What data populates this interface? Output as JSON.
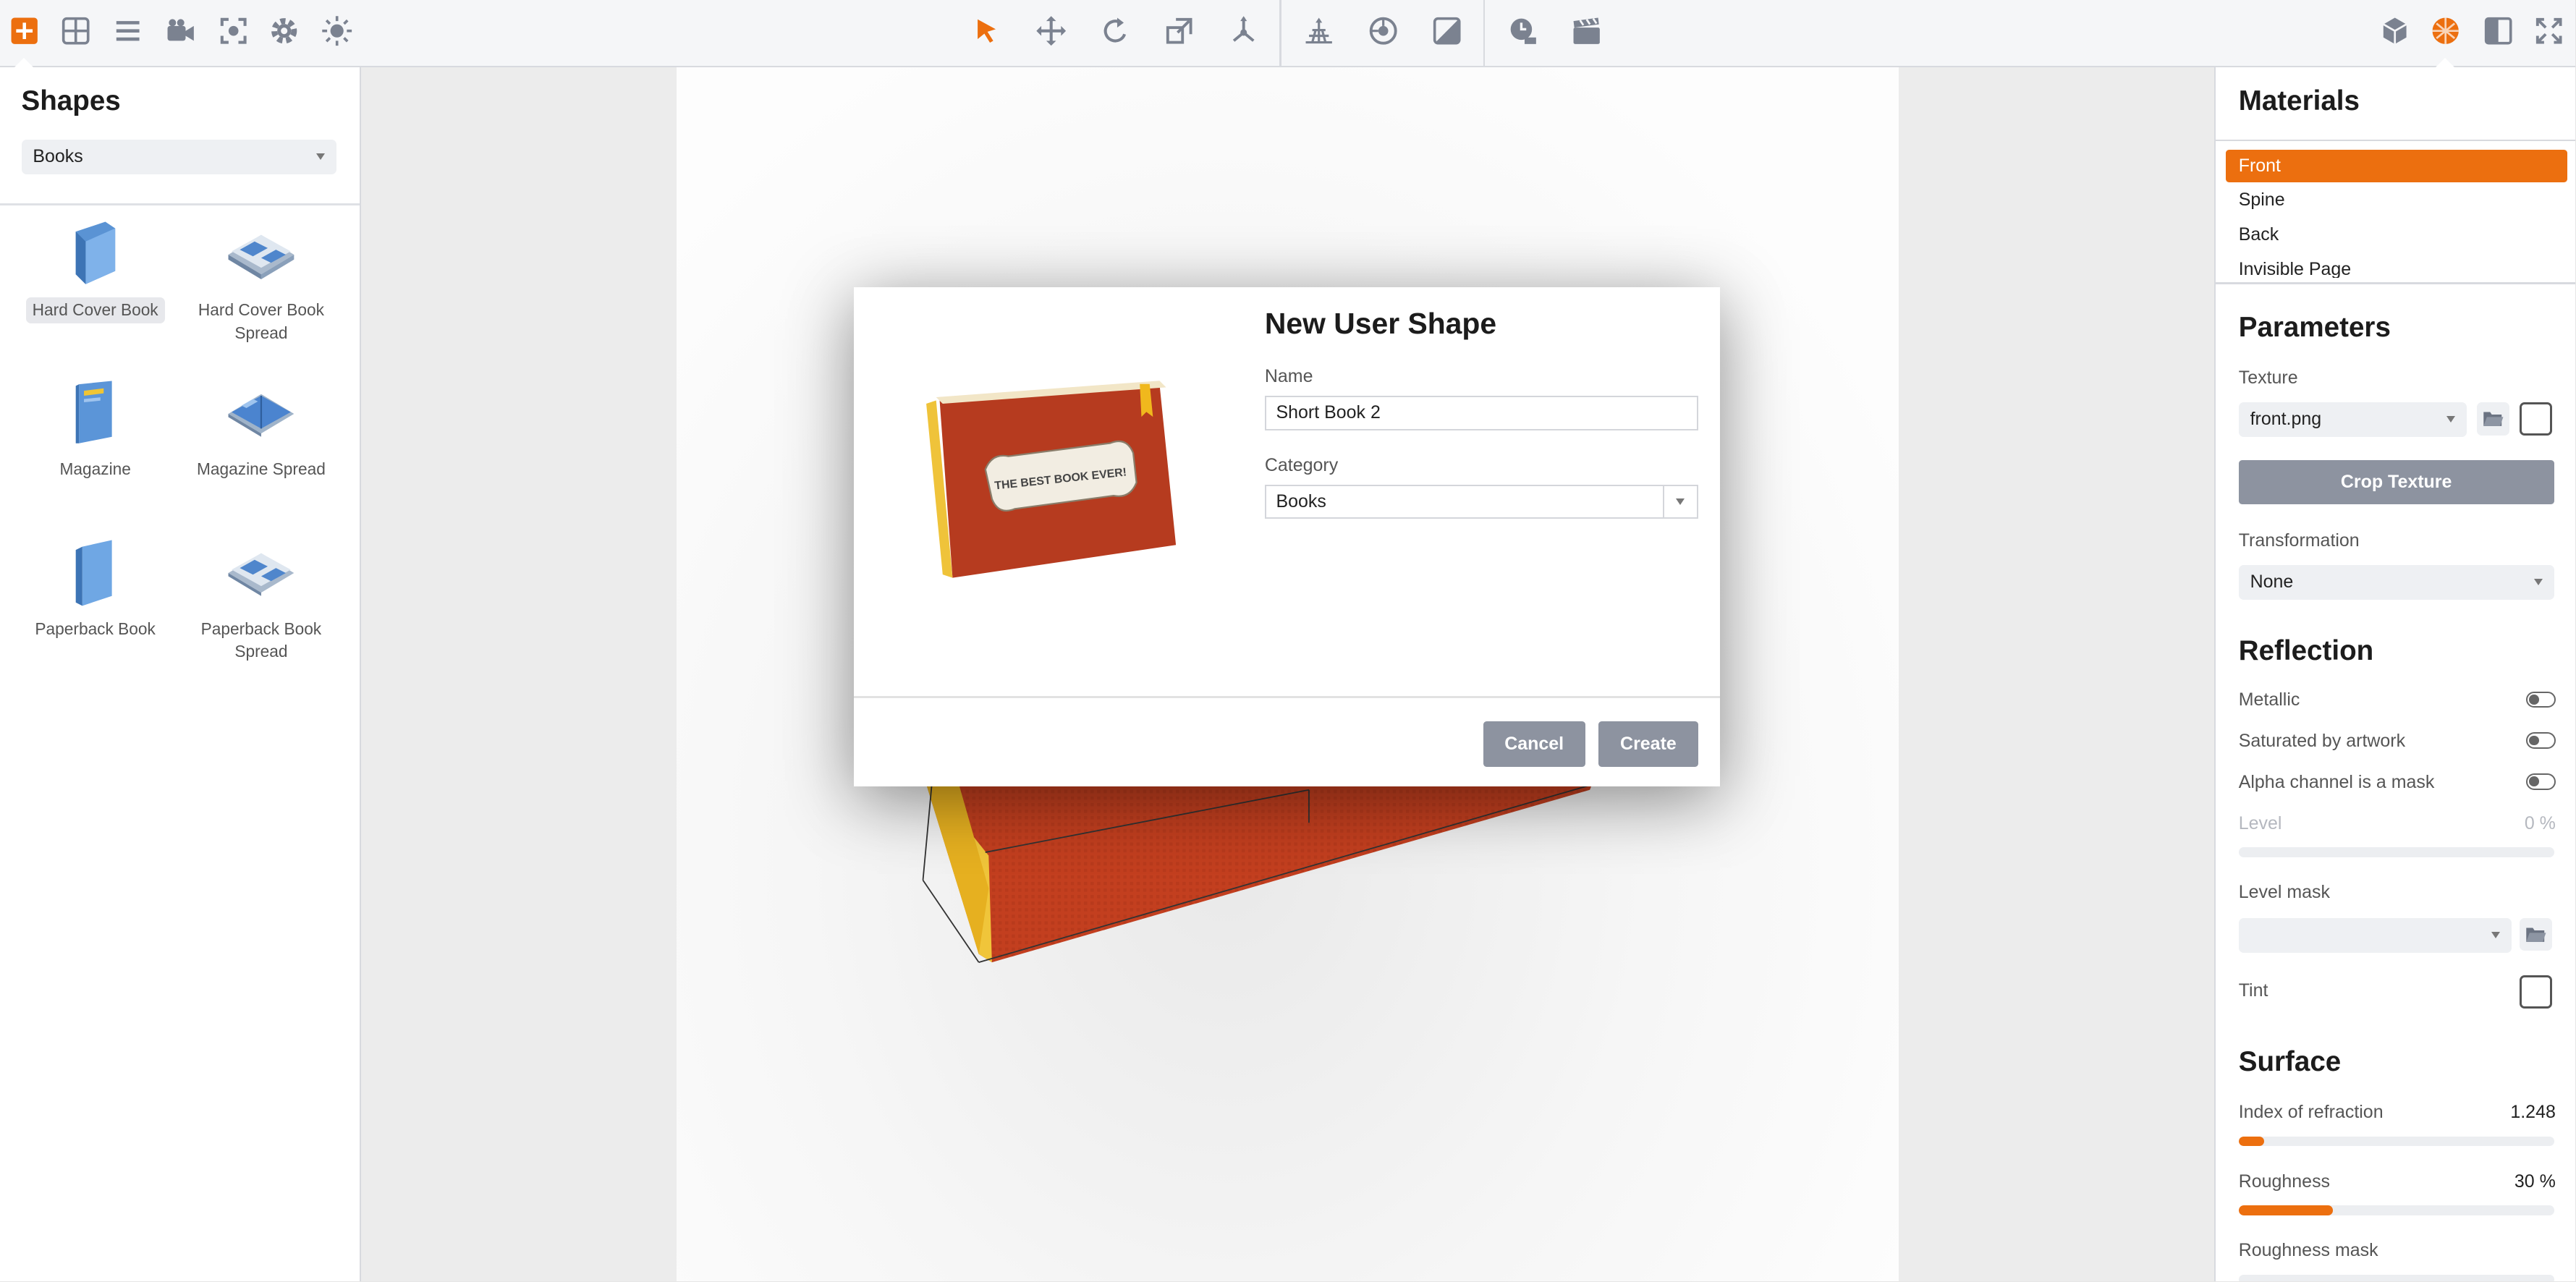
{
  "toolbar": {
    "left_icons": [
      "add-icon",
      "grid-icon",
      "list-icon",
      "camera-icon",
      "focus-icon",
      "gear-icon",
      "light-icon"
    ],
    "center_icons": [
      "select-arrow-icon",
      "move-icon",
      "rotate-icon",
      "scale-icon",
      "pivot-icon",
      "floor-grid-icon",
      "sphere-icon",
      "shading-icon",
      "time-icon",
      "clapper-icon"
    ],
    "right_icons": [
      "cube-icon",
      "material-ball-icon",
      "layout-icon",
      "fullscreen-icon"
    ],
    "accent": "#ec6f0f"
  },
  "shapes_panel": {
    "title": "Shapes",
    "category": "Books",
    "items": [
      {
        "label": "Hard Cover Book",
        "icon": "hard-cover-book-icon",
        "selected": true
      },
      {
        "label": "Hard Cover Book Spread",
        "icon": "hard-cover-spread-icon"
      },
      {
        "label": "Magazine",
        "icon": "magazine-icon"
      },
      {
        "label": "Magazine Spread",
        "icon": "magazine-spread-icon"
      },
      {
        "label": "Paperback Book",
        "icon": "paperback-book-icon"
      },
      {
        "label": "Paperback Book Spread",
        "icon": "paperback-spread-icon"
      }
    ]
  },
  "dialog": {
    "title": "New User Shape",
    "name_label": "Name",
    "name_value": "Short Book 2",
    "category_label": "Category",
    "category_value": "Books",
    "cancel_label": "Cancel",
    "create_label": "Create",
    "preview_text": "THE BEST BOOK EVER!"
  },
  "materials_panel": {
    "title": "Materials",
    "items": [
      "Front",
      "Spine",
      "Back",
      "Invisible Page"
    ],
    "active": "Front",
    "parameters": {
      "title": "Parameters",
      "texture_label": "Texture",
      "texture_value": "front.png",
      "crop_label": "Crop Texture",
      "transformation_label": "Transformation",
      "transformation_value": "None"
    },
    "reflection": {
      "title": "Reflection",
      "metallic_label": "Metallic",
      "saturated_label": "Saturated by artwork",
      "alpha_label": "Alpha channel is a mask",
      "level_label": "Level",
      "level_value": "0 %",
      "level_fraction": 0,
      "level_mask_label": "Level mask",
      "tint_label": "Tint"
    },
    "surface": {
      "title": "Surface",
      "ior_label": "Index of refraction",
      "ior_value": "1.248",
      "ior_fraction": 0.08,
      "roughness_label": "Roughness",
      "roughness_value": "30 %",
      "roughness_fraction": 0.3,
      "roughness_mask_label": "Roughness mask"
    }
  }
}
